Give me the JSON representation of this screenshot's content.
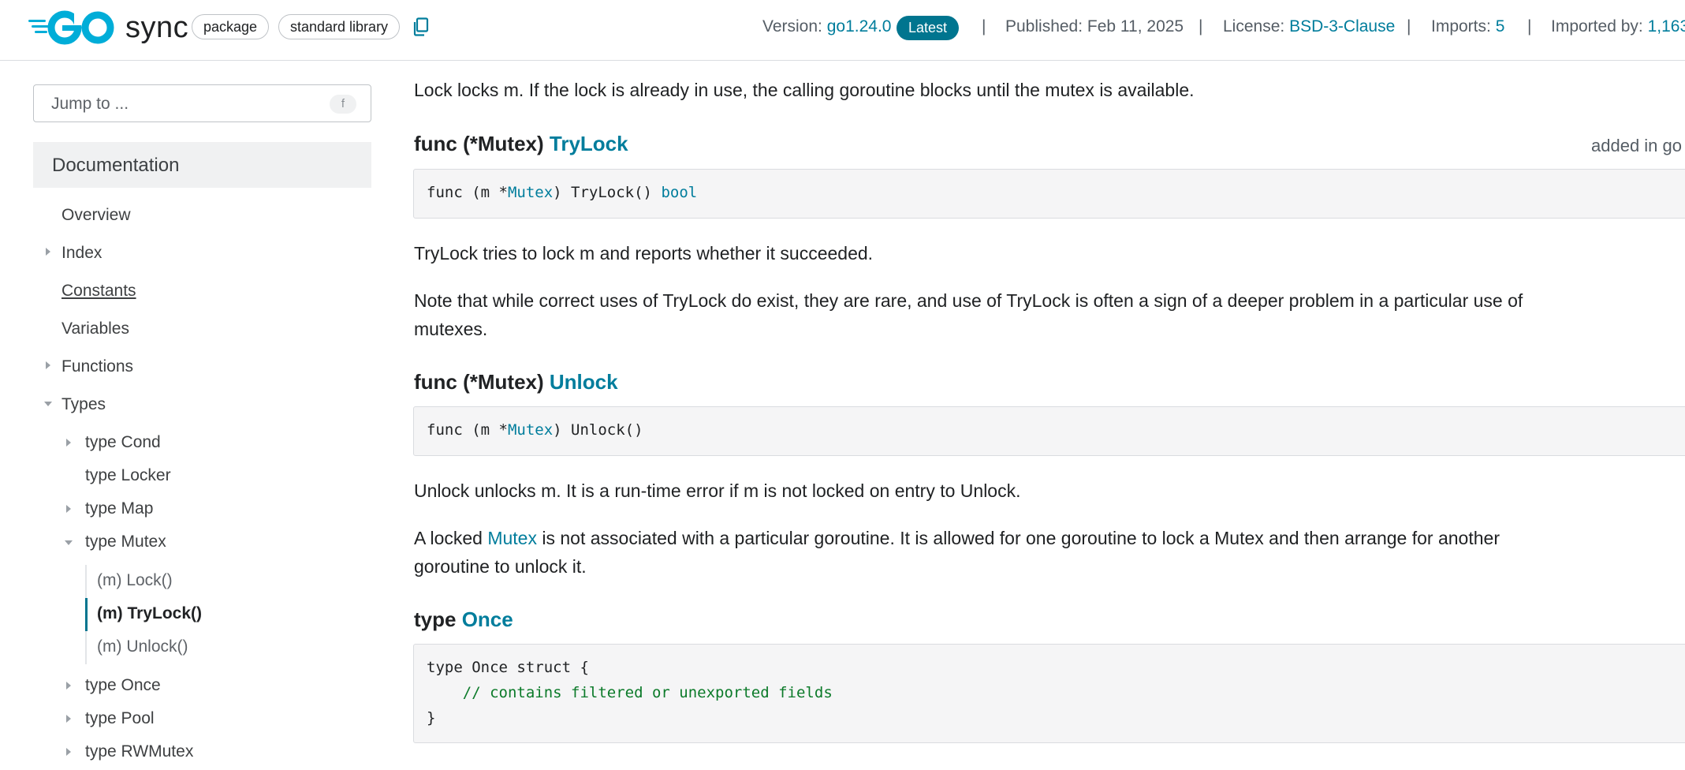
{
  "header": {
    "package_name": "sync",
    "chips": [
      "package",
      "standard library"
    ],
    "version_label": "Version:",
    "version_value": "go1.24.0",
    "latest_badge": "Latest",
    "published": "Published: Feb 11, 2025",
    "license_label": "License:",
    "license_value": "BSD-3-Clause",
    "imports_label": "Imports:",
    "imports_value": "5",
    "imported_by_label": "Imported by:",
    "imported_by_value": "1,163",
    "separator": "|"
  },
  "sidebar": {
    "jump_placeholder": "Jump to ...",
    "jump_key": "f",
    "section_title": "Documentation",
    "items": {
      "overview": "Overview",
      "index": "Index",
      "constants": "Constants",
      "variables": "Variables",
      "functions": "Functions",
      "types": "Types",
      "type_cond": "type Cond",
      "type_locker": "type Locker",
      "type_map": "type Map",
      "type_mutex": "type Mutex",
      "m_lock": "(m) Lock()",
      "m_trylock": "(m) TryLock()",
      "m_unlock": "(m) Unlock()",
      "type_once": "type Once",
      "type_pool": "type Pool",
      "type_rwmutex": "type RWMutex"
    }
  },
  "main": {
    "lock_desc": "Lock locks m. If the lock is already in use, the calling goroutine blocks until the mutex is available.",
    "trylock_heading_prefix": "func (*Mutex) ",
    "trylock_heading_name": "TryLock",
    "added_in": "added in go",
    "trylock_sig": {
      "a": "func (m *",
      "b": "Mutex",
      "c": ") TryLock() ",
      "d": "bool"
    },
    "trylock_desc1": "TryLock tries to lock m and reports whether it succeeded.",
    "trylock_desc2": "Note that while correct uses of TryLock do exist, they are rare, and use of TryLock is often a sign of a deeper problem in a particular use of mutexes.",
    "unlock_heading_prefix": "func (*Mutex) ",
    "unlock_heading_name": "Unlock",
    "unlock_sig": {
      "a": "func (m *",
      "b": "Mutex",
      "c": ") Unlock()"
    },
    "unlock_desc1": "Unlock unlocks m. It is a run-time error if m is not locked on entry to Unlock.",
    "unlock_desc2_a": "A locked ",
    "unlock_desc2_link": "Mutex",
    "unlock_desc2_b": " is not associated with a particular goroutine. It is allowed for one goroutine to lock a Mutex and then arrange for another goroutine to unlock it.",
    "once_heading_prefix": "type ",
    "once_heading_name": "Once",
    "once_code": {
      "l1": "type Once struct {",
      "l2": "    // contains filtered or unexported fields",
      "l3": "}"
    }
  },
  "colors": {
    "link": "#007d9c",
    "badge": "#00758f",
    "go_logo": "#00add8",
    "comment": "#0b7a29"
  }
}
